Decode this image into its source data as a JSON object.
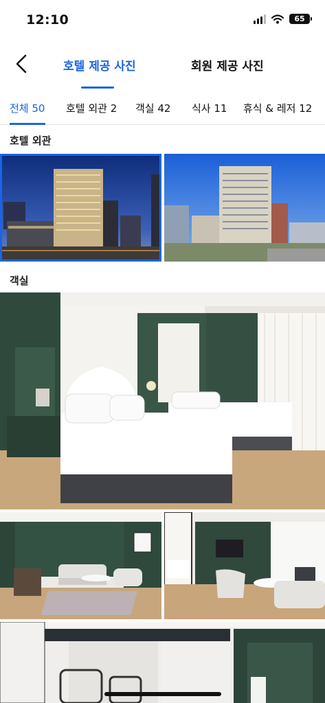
{
  "status_bar": {
    "time": "12:10",
    "battery": "65"
  },
  "top_nav": {
    "back_icon": "chevron-left-icon",
    "tabs": [
      {
        "label": "호텔 제공 사진",
        "active": true
      },
      {
        "label": "회원 제공 사진",
        "active": false
      }
    ],
    "accent_color": "#1b64e5"
  },
  "sub_tabs": [
    {
      "label": "전체 50",
      "active": true
    },
    {
      "label": "호텔 외관 2",
      "active": false
    },
    {
      "label": "객실 42",
      "active": false
    },
    {
      "label": "식사 11",
      "active": false
    },
    {
      "label": "휴식 & 레저 12",
      "active": false
    }
  ],
  "sections": [
    {
      "title": "호텔 외관"
    },
    {
      "title": "객실"
    }
  ]
}
